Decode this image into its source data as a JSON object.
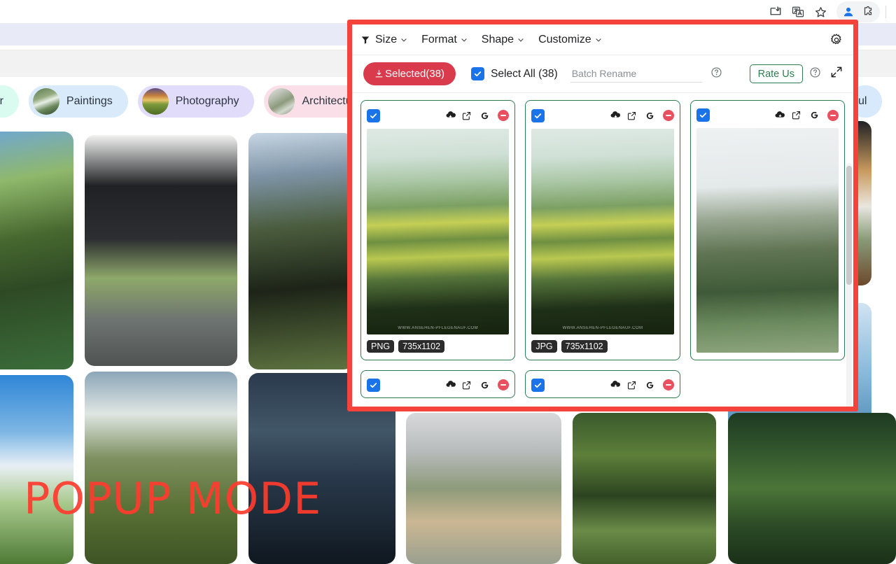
{
  "browser": {
    "icons": [
      {
        "name": "install-app-icon",
        "glyph": "install"
      },
      {
        "name": "translate-icon",
        "glyph": "translate"
      },
      {
        "name": "bookmark-star-icon",
        "glyph": "star"
      },
      {
        "name": "profile-avatar-icon",
        "glyph": "person"
      },
      {
        "name": "extensions-puzzle-icon",
        "glyph": "puzzle"
      }
    ]
  },
  "background_page": {
    "chips": [
      {
        "label": "paper",
        "full_label": "Wallpaper",
        "thumb": "waterfall-thumb",
        "color": "#d9fbf0"
      },
      {
        "label": "Paintings",
        "thumb": "waterfall-thumb",
        "color": "#d9ebfb"
      },
      {
        "label": "Photography",
        "thumb": "field-thumb",
        "color": "#e2dcfb"
      },
      {
        "label": "Architecture",
        "thumb": "rock-thumb",
        "color": "#fbdfe8"
      },
      {
        "label": "iful",
        "full_label": "Beautiful",
        "thumb": "none",
        "color": "#d7e9fb"
      }
    ],
    "watermark": "POPUP MODE",
    "watermark_color": "#ff3b2e",
    "gallery": [
      {
        "name": "stone-bridge-garden"
      },
      {
        "name": "modern-black-house"
      },
      {
        "name": "mountain-ridge-hiker"
      },
      {
        "name": "wooden-terrace-house"
      },
      {
        "name": "blue-sky-cottage"
      },
      {
        "name": "green-meadow-clouds"
      },
      {
        "name": "torii-gate-lanterns"
      },
      {
        "name": "city-plaza-aerial"
      },
      {
        "name": "forest-tram-tunnel"
      },
      {
        "name": "green-valley-river"
      },
      {
        "name": "ocean-wave"
      }
    ]
  },
  "popup": {
    "border_color": "#f4433a",
    "toolbar": {
      "filter_icon": "filter-funnel-icon",
      "menus": [
        {
          "label": "Size",
          "name": "menu-size"
        },
        {
          "label": "Format",
          "name": "menu-format"
        },
        {
          "label": "Shape",
          "name": "menu-shape"
        },
        {
          "label": "Customize",
          "name": "menu-customize"
        }
      ],
      "settings_icon": "gear-icon"
    },
    "actions": {
      "selected_label": "Selected(38)",
      "selected_color": "#d93b4c",
      "select_all_label": "Select All (38)",
      "select_all_checked": true,
      "batch_rename_placeholder": "Batch Rename",
      "batch_rename_value": "",
      "help_icon": "question-circle-icon",
      "rate_label": "Rate Us",
      "rate_color": "#2e7d4f",
      "expand_icon": "expand-fullscreen-icon"
    },
    "cards": [
      {
        "name": "image-card-1",
        "checked": true,
        "format": "PNG",
        "dimensions": "735x1102",
        "thumb": "rice-terrace-thumb",
        "image_watermark": "WWW.ANSEHEN-PFLEGENAUF.COM",
        "icons": [
          "cloud-download-icon",
          "open-external-icon",
          "google-search-icon",
          "remove-minus-icon"
        ]
      },
      {
        "name": "image-card-2",
        "checked": true,
        "format": "JPG",
        "dimensions": "735x1102",
        "thumb": "rice-terrace-thumb",
        "image_watermark": "WWW.ANSEHEN-PFLEGENAUF.COM",
        "icons": [
          "cloud-download-icon",
          "open-external-icon",
          "google-search-icon",
          "remove-minus-icon"
        ]
      },
      {
        "name": "image-card-3",
        "checked": true,
        "format": "",
        "dimensions": "",
        "thumb": "canyon-river-thumb",
        "image_watermark": "",
        "icons": [
          "cloud-download-icon",
          "open-external-icon",
          "google-search-icon",
          "remove-minus-icon"
        ]
      },
      {
        "name": "image-card-4",
        "checked": true,
        "format": "",
        "dimensions": "",
        "thumb": "",
        "image_watermark": "",
        "icons": [
          "cloud-download-icon",
          "open-external-icon",
          "google-search-icon",
          "remove-minus-icon"
        ]
      },
      {
        "name": "image-card-5",
        "checked": true,
        "format": "",
        "dimensions": "",
        "thumb": "",
        "image_watermark": "",
        "icons": [
          "cloud-download-icon",
          "open-external-icon",
          "google-search-icon",
          "remove-minus-icon"
        ]
      }
    ]
  }
}
